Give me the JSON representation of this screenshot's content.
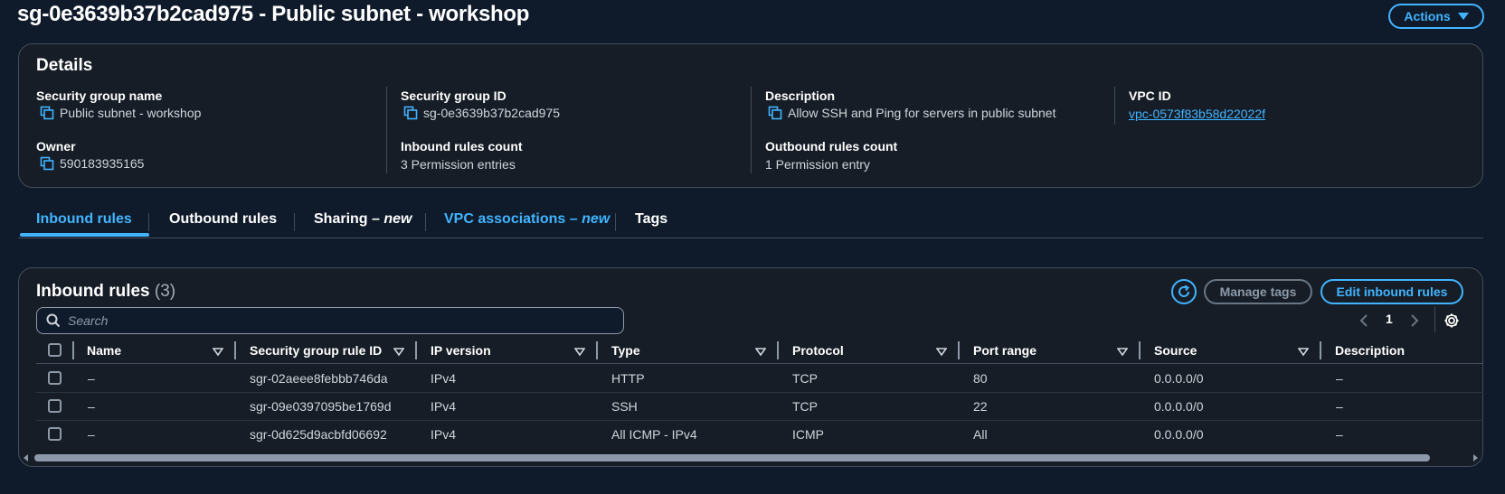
{
  "header": {
    "title": "sg-0e3639b37b2cad975 - Public subnet - workshop",
    "actions_label": "Actions"
  },
  "details": {
    "heading": "Details",
    "security_group_name_label": "Security group name",
    "security_group_name": "Public subnet - workshop",
    "security_group_id_label": "Security group ID",
    "security_group_id": "sg-0e3639b37b2cad975",
    "description_label": "Description",
    "description": "Allow SSH and Ping for servers in public subnet",
    "vpc_id_label": "VPC ID",
    "vpc_id": "vpc-0573f83b58d22022f",
    "owner_label": "Owner",
    "owner": "590183935165",
    "inbound_count_label": "Inbound rules count",
    "inbound_count": "3 Permission entries",
    "outbound_count_label": "Outbound rules count",
    "outbound_count": "1 Permission entry"
  },
  "tabs": [
    {
      "label": "Inbound rules"
    },
    {
      "label": "Outbound rules"
    },
    {
      "label": "Sharing – ",
      "badge": "new"
    },
    {
      "label": "VPC associations – ",
      "badge": "new"
    },
    {
      "label": "Tags"
    }
  ],
  "rules": {
    "title": "Inbound rules",
    "count": "(3)",
    "manage_tags_label": "Manage tags",
    "edit_label": "Edit inbound rules",
    "search_placeholder": "Search",
    "page": "1",
    "columns": [
      "Name",
      "Security group rule ID",
      "IP version",
      "Type",
      "Protocol",
      "Port range",
      "Source",
      "Description"
    ],
    "rows": [
      {
        "name": "–",
        "rule_id": "sgr-02aeee8febbb746da",
        "ip_version": "IPv4",
        "type": "HTTP",
        "protocol": "TCP",
        "port_range": "80",
        "source": "0.0.0.0/0",
        "description": "–"
      },
      {
        "name": "–",
        "rule_id": "sgr-09e0397095be1769d",
        "ip_version": "IPv4",
        "type": "SSH",
        "protocol": "TCP",
        "port_range": "22",
        "source": "0.0.0.0/0",
        "description": "–"
      },
      {
        "name": "–",
        "rule_id": "sgr-0d625d9acbfd06692",
        "ip_version": "IPv4",
        "type": "All ICMP - IPv4",
        "protocol": "ICMP",
        "port_range": "All",
        "source": "0.0.0.0/0",
        "description": "–"
      }
    ]
  },
  "colors": {
    "background": "#0f1b2a",
    "card": "#161d26",
    "accent": "#42b4ff",
    "border": "#414d5c"
  }
}
